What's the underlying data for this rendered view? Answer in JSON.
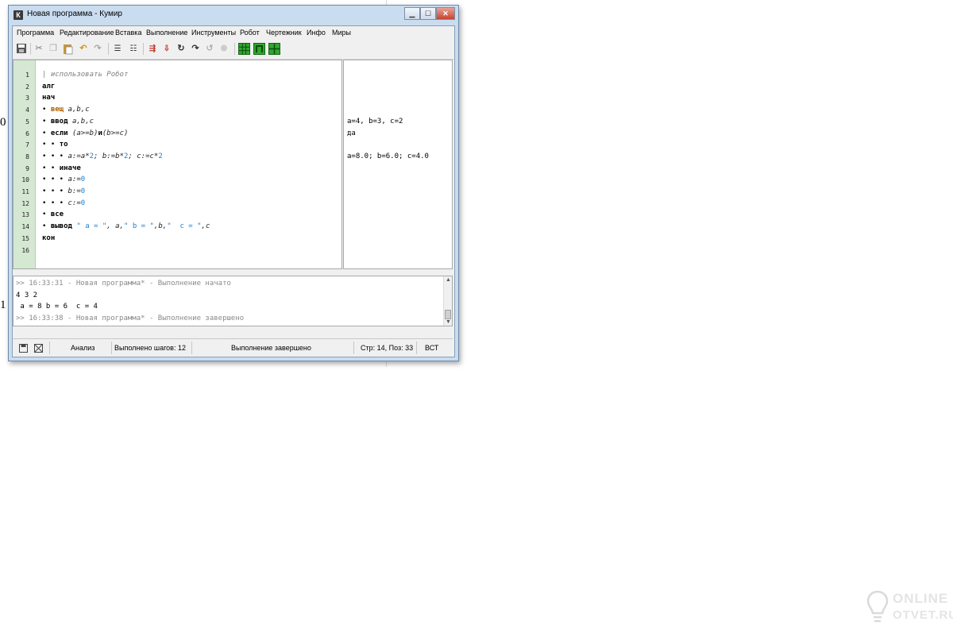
{
  "window": {
    "title": "Новая программа - Кумир",
    "app_icon": "К",
    "buttons": {
      "minimize": "▁",
      "maximize": "☐",
      "close": "✕"
    }
  },
  "menu": [
    "Программа",
    "Редактирование",
    "Вставка",
    "Выполнение",
    "Инструменты",
    "Робот",
    "Чертежник",
    "Инфо",
    "Миры"
  ],
  "toolbar": {
    "icons": [
      "save-icon",
      "cut-icon",
      "copy-icon",
      "paste-icon",
      "undo-icon",
      "redo-icon",
      "indent-icon",
      "unindent-icon",
      "run-icon",
      "step-icon",
      "step-in-icon",
      "step-over-icon",
      "step-out-icon",
      "stop-icon",
      "robot-grid-icon",
      "drawer-icon",
      "field-icon"
    ],
    "accent_green": "#2ea72e"
  },
  "editor": {
    "line_numbers": [
      "1",
      "2",
      "3",
      "4",
      "5",
      "6",
      "7",
      "8",
      "9",
      "10",
      "11",
      "12",
      "13",
      "14",
      "15",
      "16"
    ],
    "lines": {
      "l1_comment": "| использовать Робот",
      "l2_alg": "алг",
      "l3_nach": "нач",
      "l4_bullet": "• ",
      "l4_type": "вещ",
      "l4_vars": " a,b,c",
      "l5_bullet": "• ",
      "l5_kw": "ввод",
      "l5_vars": " a,b,c",
      "l6_bullet": "• ",
      "l6_kw": "если",
      "l6_cond1": " (a>=b)",
      "l6_and": "и",
      "l6_cond2": "(b>=c)",
      "l7_bullet": "• • ",
      "l7_kw": "то",
      "l8_bullet": "• • • ",
      "l8_a": "a:=a*",
      "l8_2a": "2",
      "l8_b": "; b:=b*",
      "l8_2b": "2",
      "l8_c": "; c:=c*",
      "l8_2c": "2",
      "l9_bullet": "• • ",
      "l9_kw": "иначе",
      "l10_bullet": "• • • ",
      "l10_var": "a:=",
      "l10_zero": "0",
      "l11_bullet": "• • • ",
      "l11_var": "b:=",
      "l11_zero": "0",
      "l12_bullet": "• • • ",
      "l12_var": "c:=",
      "l12_zero": "0",
      "l13_bullet": "• ",
      "l13_kw": "все",
      "l14_bullet": "• ",
      "l14_kw": "вывод",
      "l14_s1": " \" a = \"",
      "l14_v1": ", a,",
      "l14_s2": "\" b = \"",
      "l14_v2": ",b,",
      "l14_s3": "\"  c = \"",
      "l14_v3": ",c",
      "l15_kon": "кон"
    }
  },
  "margin": {
    "line5": "a=4, b=3, c=2",
    "line6": "да",
    "line8": "a=8.0; b=6.0; c=4.0"
  },
  "console": {
    "line1": ">> 16:33:31 - Новая программа* - Выполнение начато",
    "line2": "4 3 2",
    "line3": " a = 8 b = 6  c = 4",
    "line4": ">> 16:33:38 - Новая программа* - Выполнение завершено"
  },
  "statusbar": {
    "mode": "Анализ",
    "steps": "Выполнено шагов: 12",
    "state": "Выполнение завершено",
    "position": "Стр: 14, Поз: 33",
    "insert": "ВСТ"
  },
  "background": {
    "left_chars": [
      "0",
      "1"
    ],
    "watermark_line1": "ONLINE",
    "watermark_line2": "OTVET.RU"
  }
}
